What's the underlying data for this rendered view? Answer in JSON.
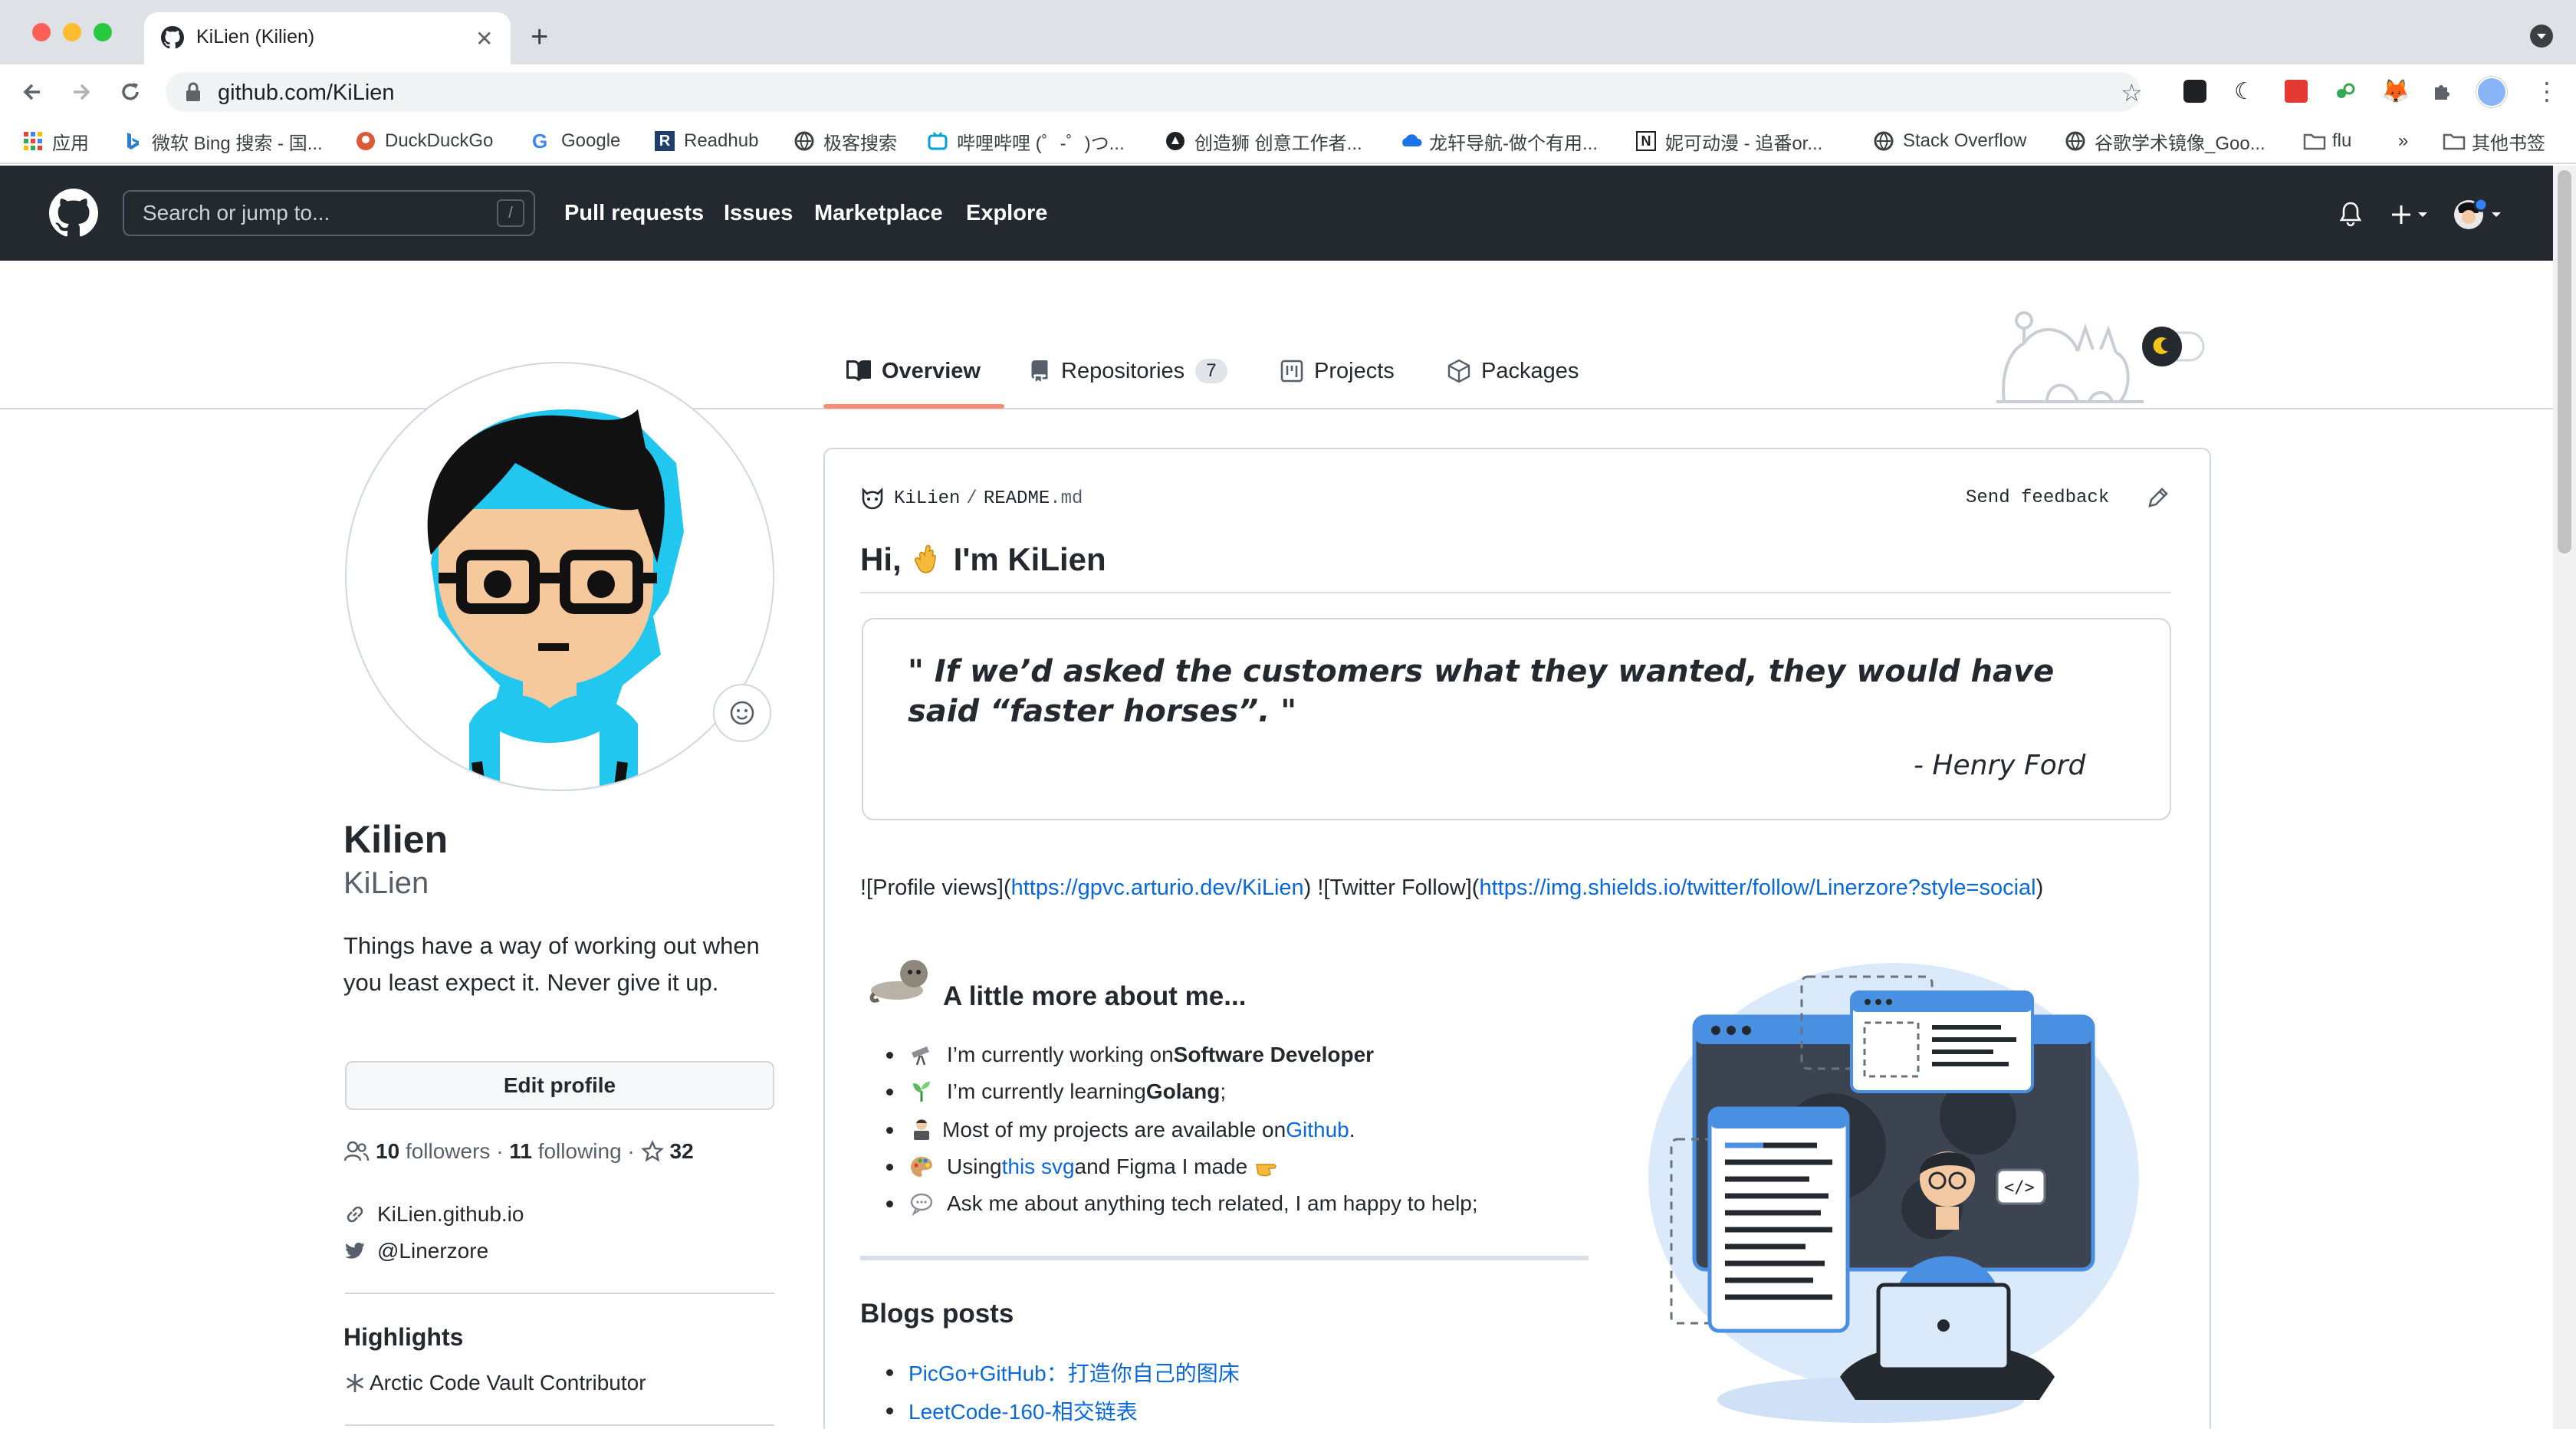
{
  "browser": {
    "tab_title": "KiLien (Kilien)",
    "url": "github.com/KiLien",
    "bookmarks": [
      {
        "label": "应用",
        "icon": "apps-grid-icon"
      },
      {
        "label": "微软 Bing 搜索 - 国...",
        "icon": "bing-icon"
      },
      {
        "label": "DuckDuckGo",
        "icon": "duckduckgo-icon"
      },
      {
        "label": "Google",
        "icon": "google-icon"
      },
      {
        "label": "Readhub",
        "icon": "readhub-icon"
      },
      {
        "label": "极客搜索",
        "icon": "globe-icon"
      },
      {
        "label": "哔哩哔哩 (゜-゜)つ...",
        "icon": "bilibili-icon"
      },
      {
        "label": "创造狮 创意工作者...",
        "icon": "chuangzaoshi-icon"
      },
      {
        "label": "龙轩导航-做个有用...",
        "icon": "cloud-icon"
      },
      {
        "label": "妮可动漫 - 追番or...",
        "icon": "notion-icon"
      },
      {
        "label": "Stack Overflow",
        "icon": "globe-icon"
      },
      {
        "label": "谷歌学术镜像_Goo...",
        "icon": "globe-icon"
      },
      {
        "label": "flu",
        "icon": "folder-icon"
      },
      {
        "label": "»",
        "icon": ""
      },
      {
        "label": "其他书签",
        "icon": "folder-icon"
      }
    ]
  },
  "header": {
    "search_placeholder": "Search or jump to...",
    "slash_hint": "/",
    "nav": [
      "Pull requests",
      "Issues",
      "Marketplace",
      "Explore"
    ]
  },
  "profile_tabs": [
    {
      "label": "Overview",
      "active": true
    },
    {
      "label": "Repositories",
      "count": "7"
    },
    {
      "label": "Projects"
    },
    {
      "label": "Packages"
    }
  ],
  "profile": {
    "name": "Kilien",
    "login": "KiLien",
    "bio": "Things have a way of working out when you least expect it. Never give it up.",
    "edit_button": "Edit profile",
    "followers_count": "10",
    "followers_label": "followers",
    "following_count": "11",
    "following_label": "following",
    "stars_count": "32",
    "website": "KiLien.github.io",
    "twitter": "@Linerzore",
    "highlights_title": "Highlights",
    "highlight_item": "Arctic Code Vault Contributor"
  },
  "readme": {
    "owner": "KiLien",
    "separator": "/",
    "filename": "README",
    "ext": ".md",
    "send_feedback": "Send feedback",
    "heading_before": "Hi,",
    "heading_after": "I'm KiLien",
    "quote": "\" If we’d asked the customers what they wanted, they would have said “faster horses”. \"",
    "quote_author": "- Henry Ford",
    "badges": {
      "p1": "![Profile views](",
      "link1": "https://gpvc.arturio.dev/KiLien",
      "p2": ") ![Twitter Follow](",
      "link2": "https://img.shields.io/twitter/follow/Linerzore?style=social",
      "p3": ")"
    },
    "about_title": "A little more about me...",
    "about_items": {
      "i1_pre": "I’m currently working on ",
      "i1_bold": "Software Developer",
      "i2_pre": "I’m currently learning ",
      "i2_bold": "Golang",
      "i2_post": ";",
      "i3_pre": "Most of my projects are available on ",
      "i3_link": "Github",
      "i3_post": ".",
      "i4_pre": "Using ",
      "i4_link": "this svg",
      "i4_post": " and Figma I made",
      "i5": "Ask me about anything tech related, I am happy to help;"
    },
    "blogs_title": "Blogs posts",
    "blogs": [
      "PicGo+GitHub：打造你自己的图床",
      "LeetCode-160-相交链表"
    ]
  },
  "colors": {
    "header_bg": "#24292f",
    "link": "#0969da",
    "tab_underline": "#fd8c73",
    "illustration_blue": "#4a90e2"
  }
}
